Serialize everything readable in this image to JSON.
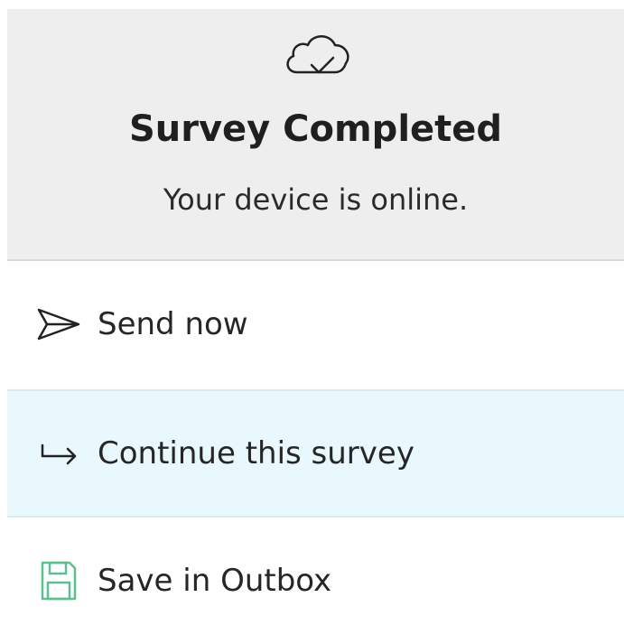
{
  "header": {
    "icon": "cloud-check-icon",
    "title": "Survey Completed",
    "status": "Your device is online."
  },
  "options": [
    {
      "icon": "send-icon",
      "label": "Send now"
    },
    {
      "icon": "forward-arrow-icon",
      "label": "Continue this survey",
      "highlighted": true
    },
    {
      "icon": "save-disk-icon",
      "label": "Save in Outbox"
    }
  ],
  "colors": {
    "header_bg": "#eeeeee",
    "highlight_bg": "#e8f8fc",
    "save_icon": "#5fbf8f"
  }
}
